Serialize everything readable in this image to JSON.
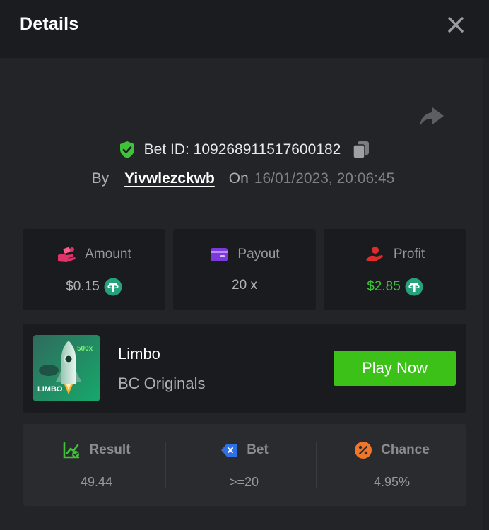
{
  "header": {
    "title": "Details"
  },
  "bet": {
    "label": "Bet ID: 109268911517600182",
    "by_label": "By",
    "username": "Yivwlezckwb",
    "on_label": "On",
    "datetime": "16/01/2023, 20:06:45"
  },
  "stats": {
    "amount": {
      "label": "Amount",
      "value": "$0.15"
    },
    "payout": {
      "label": "Payout",
      "value": "20 x"
    },
    "profit": {
      "label": "Profit",
      "value": "$2.85"
    }
  },
  "game": {
    "name": "Limbo",
    "provider": "BC Originals",
    "thumb_badge": "500x",
    "thumb_text": "LIMBO",
    "play_label": "Play Now"
  },
  "results": {
    "result": {
      "label": "Result",
      "value": "49.44"
    },
    "bet": {
      "label": "Bet",
      "value": ">=20"
    },
    "chance": {
      "label": "Chance",
      "value": "4.95%"
    }
  },
  "colors": {
    "accent_green": "#3bc117",
    "profit_green": "#3fc239",
    "tether": "#26a17b"
  }
}
